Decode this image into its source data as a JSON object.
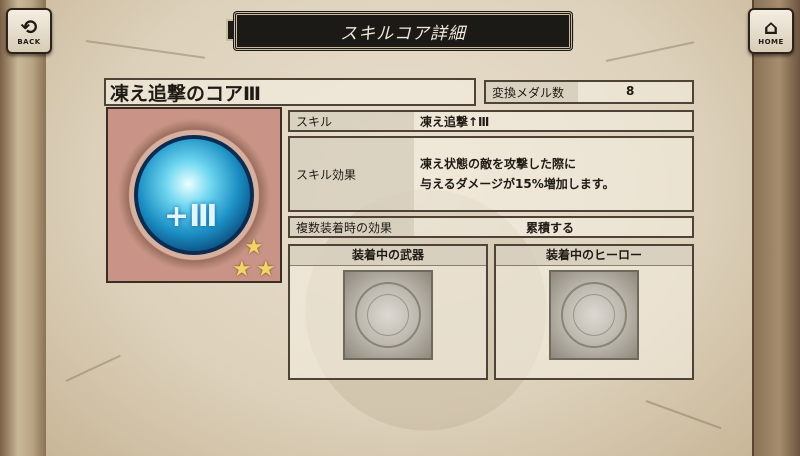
{
  "nav": {
    "back_label": "BACK",
    "home_label": "HOME"
  },
  "header": {
    "title": "スキルコア詳細"
  },
  "core": {
    "name": "凍え追撃のコアⅢ",
    "medal_label": "変換メダル数",
    "medal_value": "8",
    "stars": 3,
    "orb_glyph": "+Ⅲ"
  },
  "skill": {
    "skill_label": "スキル",
    "skill_value": "凍え追撃↑Ⅲ",
    "effect_label": "スキル効果",
    "effect_line1": "凍え状態の敵を攻撃した際に",
    "effect_line2": "与えるダメージが15%増加します。",
    "stack_label": "複数装着時の効果",
    "stack_value": "累積する"
  },
  "equipped": {
    "weapon_title": "装着中の武器",
    "hero_title": "装着中のヒーロー"
  }
}
